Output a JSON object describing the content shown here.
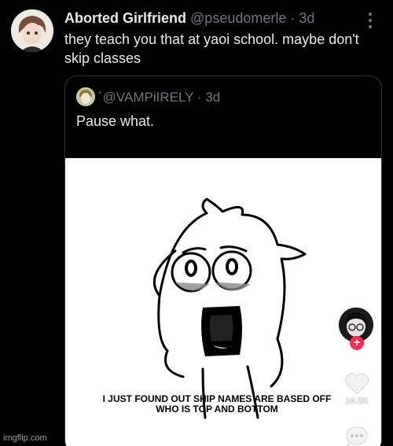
{
  "tweet": {
    "display_name": "Aborted Girlfriend",
    "handle": "@pseudomerle",
    "separator": "·",
    "time": "3d",
    "text": "they teach you that at yaoi school. maybe don't skip classes",
    "avatar_icon": "user-avatar",
    "more_icon": "more-vertical-icon"
  },
  "quote": {
    "handle": "´@VAMPiIRELY",
    "separator": "·",
    "time": "3d",
    "text": "Pause what.",
    "avatar_icon": "user-avatar"
  },
  "media": {
    "caption": "I JUST FOUND OUT SHIP NAMES ARE BASED OFF WHO IS TOP AND BOTTOM",
    "like_count": "10.2K",
    "follow_badge": "+",
    "icons": [
      "side-avatar",
      "heart-icon",
      "comment-icon"
    ],
    "colors": {
      "follow_badge": "#fe2c55"
    }
  },
  "watermark": "imgflip.com"
}
